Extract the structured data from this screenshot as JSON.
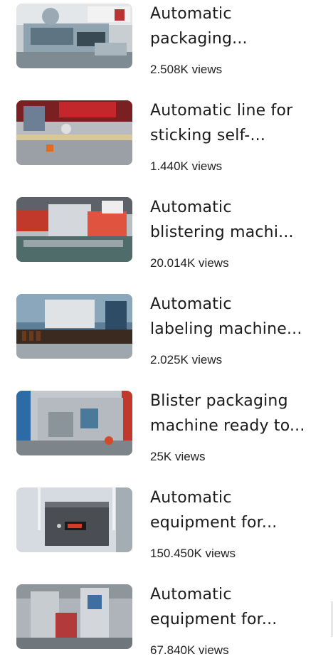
{
  "videos": [
    {
      "title": "Automatic\npackaging...",
      "views": "2.508K views",
      "thumb_icon": "packaging-machine-thumbnail"
    },
    {
      "title": "Automatic line for\nsticking self-...",
      "views": "1.440K views",
      "thumb_icon": "sticking-line-thumbnail"
    },
    {
      "title": "Automatic\nblistering machi...",
      "views": "20.014K views",
      "thumb_icon": "blistering-machine-thumbnail"
    },
    {
      "title": "Automatic\nlabeling machine...",
      "views": "2.025K views",
      "thumb_icon": "labeling-machine-thumbnail"
    },
    {
      "title": "Blister packaging\nmachine ready to...",
      "views": "25K views",
      "thumb_icon": "blister-packaging-thumbnail"
    },
    {
      "title": "Automatic\nequipment for...",
      "views": "150.450K views",
      "thumb_icon": "filling-equipment-thumbnail"
    },
    {
      "title": "Automatic\nequipment for...",
      "views": "67.840K views",
      "thumb_icon": "vertical-packer-thumbnail"
    }
  ]
}
